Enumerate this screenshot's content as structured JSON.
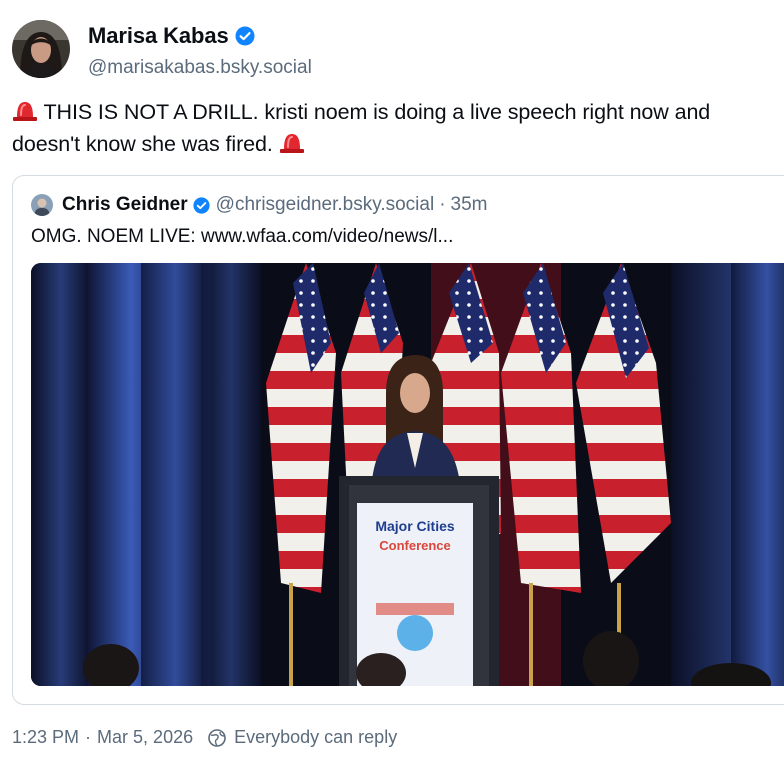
{
  "post": {
    "author": {
      "display_name": "Marisa Kabas",
      "handle": "@marisakabas.bsky.social",
      "verified": true,
      "avatar_icon": "author-avatar"
    },
    "text_part1": " THIS IS NOT A DRILL. kristi noem is doing a live speech right now and doesn't know she was fired. ",
    "emoji": "police-car-light (siren)"
  },
  "quote": {
    "author": {
      "display_name": "Chris Geidner",
      "handle": "@chrisgeidner.bsky.social",
      "verified": true
    },
    "separator": "·",
    "time": "35m",
    "text": "OMG. NOEM LIVE: www.wfaa.com/video/news/l...",
    "media": {
      "podium_line1": "Major Cities",
      "podium_line2": "Conference"
    }
  },
  "footer": {
    "time": "1:23 PM",
    "separator": "·",
    "date": "Mar 5, 2026",
    "reply_setting": "Everybody can reply"
  },
  "colors": {
    "verified_blue": "#1083fe",
    "secondary_text": "#5b6b7c",
    "border": "#d4dbe2",
    "siren_red": "#e0282e"
  }
}
